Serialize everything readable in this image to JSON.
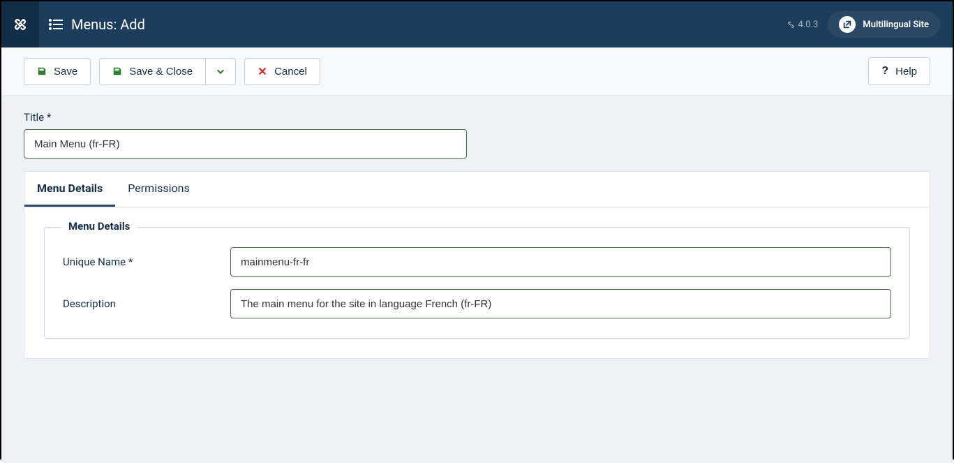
{
  "header": {
    "title": "Menus: Add",
    "version": "4.0.3",
    "site_link": "Multilingual Site"
  },
  "toolbar": {
    "save": "Save",
    "save_close": "Save & Close",
    "cancel": "Cancel",
    "help": "Help"
  },
  "form": {
    "title_label": "Title *",
    "title_value": "Main Menu (fr-FR)"
  },
  "tabs": {
    "menu_details": "Menu Details",
    "permissions": "Permissions"
  },
  "fieldset": {
    "legend": "Menu Details",
    "unique_name_label": "Unique Name *",
    "unique_name_value": "mainmenu-fr-fr",
    "description_label": "Description",
    "description_value": "The main menu for the site in language French (fr-FR)"
  }
}
